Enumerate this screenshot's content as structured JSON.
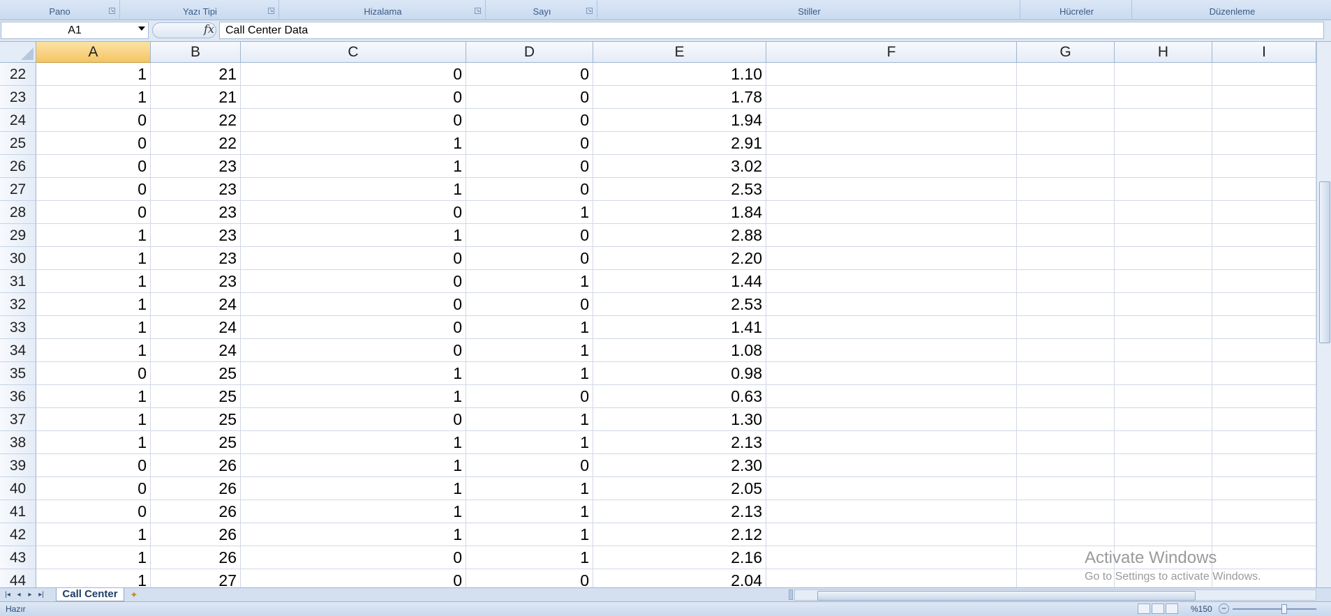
{
  "ribbon": {
    "groups": [
      "Pano",
      "Yazı Tipi",
      "Hizalama",
      "Sayı",
      "Stiller",
      "Hücreler",
      "Düzenleme"
    ]
  },
  "formula_bar": {
    "name_box": "A1",
    "fx_symbol": "fx",
    "content": "Call Center Data"
  },
  "sheet": {
    "columns": [
      "A",
      "B",
      "C",
      "D",
      "E",
      "F",
      "G",
      "H",
      "I"
    ],
    "selected_column": "A",
    "rows": [
      {
        "row": "22",
        "a": "1",
        "b": "21",
        "c": "0",
        "d": "0",
        "e": "1.10"
      },
      {
        "row": "23",
        "a": "1",
        "b": "21",
        "c": "0",
        "d": "0",
        "e": "1.78"
      },
      {
        "row": "24",
        "a": "0",
        "b": "22",
        "c": "0",
        "d": "0",
        "e": "1.94"
      },
      {
        "row": "25",
        "a": "0",
        "b": "22",
        "c": "1",
        "d": "0",
        "e": "2.91"
      },
      {
        "row": "26",
        "a": "0",
        "b": "23",
        "c": "1",
        "d": "0",
        "e": "3.02"
      },
      {
        "row": "27",
        "a": "0",
        "b": "23",
        "c": "1",
        "d": "0",
        "e": "2.53"
      },
      {
        "row": "28",
        "a": "0",
        "b": "23",
        "c": "0",
        "d": "1",
        "e": "1.84"
      },
      {
        "row": "29",
        "a": "1",
        "b": "23",
        "c": "1",
        "d": "0",
        "e": "2.88"
      },
      {
        "row": "30",
        "a": "1",
        "b": "23",
        "c": "0",
        "d": "0",
        "e": "2.20"
      },
      {
        "row": "31",
        "a": "1",
        "b": "23",
        "c": "0",
        "d": "1",
        "e": "1.44"
      },
      {
        "row": "32",
        "a": "1",
        "b": "24",
        "c": "0",
        "d": "0",
        "e": "2.53"
      },
      {
        "row": "33",
        "a": "1",
        "b": "24",
        "c": "0",
        "d": "1",
        "e": "1.41"
      },
      {
        "row": "34",
        "a": "1",
        "b": "24",
        "c": "0",
        "d": "1",
        "e": "1.08"
      },
      {
        "row": "35",
        "a": "0",
        "b": "25",
        "c": "1",
        "d": "1",
        "e": "0.98"
      },
      {
        "row": "36",
        "a": "1",
        "b": "25",
        "c": "1",
        "d": "0",
        "e": "0.63"
      },
      {
        "row": "37",
        "a": "1",
        "b": "25",
        "c": "0",
        "d": "1",
        "e": "1.30"
      },
      {
        "row": "38",
        "a": "1",
        "b": "25",
        "c": "1",
        "d": "1",
        "e": "2.13"
      },
      {
        "row": "39",
        "a": "0",
        "b": "26",
        "c": "1",
        "d": "0",
        "e": "2.30"
      },
      {
        "row": "40",
        "a": "0",
        "b": "26",
        "c": "1",
        "d": "1",
        "e": "2.05"
      },
      {
        "row": "41",
        "a": "0",
        "b": "26",
        "c": "1",
        "d": "1",
        "e": "2.13"
      },
      {
        "row": "42",
        "a": "1",
        "b": "26",
        "c": "1",
        "d": "1",
        "e": "2.12"
      },
      {
        "row": "43",
        "a": "1",
        "b": "26",
        "c": "0",
        "d": "1",
        "e": "2.16"
      },
      {
        "row": "44",
        "a": "1",
        "b": "27",
        "c": "0",
        "d": "0",
        "e": "2.04"
      }
    ]
  },
  "tabs": {
    "active_sheet": "Call Center"
  },
  "status_bar": {
    "status": "Hazır",
    "zoom": "%150"
  },
  "watermark": {
    "title": "Activate Windows",
    "subtitle": "Go to Settings to activate Windows."
  }
}
